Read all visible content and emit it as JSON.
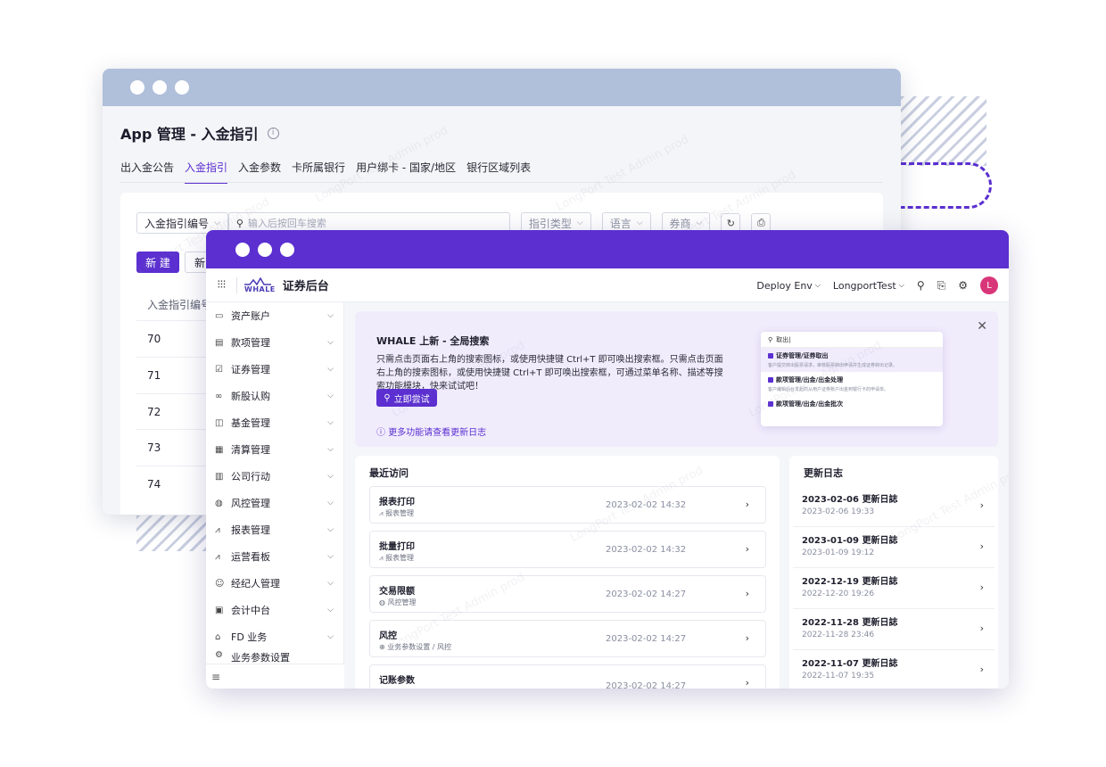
{
  "back_window": {
    "title": "App 管理 - 入金指引",
    "info_icon": "i",
    "tabs": [
      {
        "label": "出入金公告",
        "active": false
      },
      {
        "label": "入金指引",
        "active": true
      },
      {
        "label": "入金参数",
        "active": false
      },
      {
        "label": "卡所属银行",
        "active": false
      },
      {
        "label": "用户绑卡 - 国家/地区",
        "active": false
      },
      {
        "label": "银行区域列表",
        "active": false
      }
    ],
    "filters": {
      "field_select": "入金指引编号",
      "search_placeholder": "输入后按回车搜索",
      "type_select": "指引类型",
      "lang_select": "语言",
      "broker_select": "券商"
    },
    "buttons": {
      "new": "新 建",
      "new2": "新"
    },
    "table": {
      "column_header": "入金指引编号",
      "rows": [
        "70",
        "71",
        "72",
        "73",
        "74"
      ]
    }
  },
  "front_window": {
    "brand": {
      "logo_text": "WHALE",
      "title": "证券后台"
    },
    "header": {
      "env": "Deploy Env",
      "account": "LongportTest",
      "avatar": "L"
    },
    "sidebar": {
      "items": [
        {
          "label": "资产账户",
          "icon": "wallet-icon"
        },
        {
          "label": "款项管理",
          "icon": "document-icon"
        },
        {
          "label": "证券管理",
          "icon": "check-square-icon"
        },
        {
          "label": "新股认购",
          "icon": "link-icon"
        },
        {
          "label": "基金管理",
          "icon": "chart-box-icon"
        },
        {
          "label": "清算管理",
          "icon": "calendar-icon"
        },
        {
          "label": "公司行动",
          "icon": "building-icon"
        },
        {
          "label": "风控管理",
          "icon": "shield-icon"
        },
        {
          "label": "报表管理",
          "icon": "line-chart-icon"
        },
        {
          "label": "运营看板",
          "icon": "trend-icon"
        },
        {
          "label": "经纪人管理",
          "icon": "users-icon"
        },
        {
          "label": "会计中台",
          "icon": "ledger-icon"
        },
        {
          "label": "FD 业务",
          "icon": "bank-icon"
        },
        {
          "label": "业务参数设置",
          "icon": "settings-icon"
        }
      ],
      "collapse_icon": "≡"
    },
    "banner": {
      "title": "WHALE 上新 - 全局搜索",
      "desc": "只需点击页面右上角的搜索图标，或使用快捷键 Ctrl+T 即可唤出搜索框。只需点击页面右上角的搜索图标，或使用快捷键 Ctrl+T 即可唤出搜索框，可通过菜单名称、描述等搜索功能模块，快来试试吧！",
      "try_button": "立即尝试",
      "more_link": "更多功能请查看更新日志",
      "mini_search": {
        "query": "取出|",
        "results": [
          {
            "title": "证券管理/证券取出",
            "desc": "客户提交转出股票请求，审核股票转出申请并生成证券转出记录。"
          },
          {
            "title": "款项管理/出金/出金处理",
            "desc": "客户编辑后台发起的从用户证券账户出金到银行卡的申请单。"
          },
          {
            "title": "款项管理/出金/出金批次",
            "desc": ""
          }
        ]
      }
    },
    "recent": {
      "title": "最近访问",
      "items": [
        {
          "name": "报表打印",
          "path": "报表管理",
          "time": "2023-02-02 14:32"
        },
        {
          "name": "批量打印",
          "path": "报表管理",
          "time": "2023-02-02 14:32"
        },
        {
          "name": "交易限额",
          "path": "风控管理",
          "time": "2023-02-02 14:27"
        },
        {
          "name": "风控",
          "path": "业务参数设置  /  风控",
          "time": "2023-02-02 14:27"
        },
        {
          "name": "记账参数",
          "path": "",
          "time": "2023-02-02 14:27"
        }
      ]
    },
    "changelog": {
      "title": "更新日志",
      "items": [
        {
          "title": "2023-02-06 更新日誌",
          "date": "2023-02-06 19:33"
        },
        {
          "title": "2023-01-09 更新日誌",
          "date": "2023-01-09 19:12"
        },
        {
          "title": "2022-12-19 更新日誌",
          "date": "2022-12-20 19:26"
        },
        {
          "title": "2022-11-28 更新日誌",
          "date": "2022-11-28 23:46"
        },
        {
          "title": "2022-11-07 更新日誌",
          "date": "2022-11-07 19:35"
        }
      ]
    }
  },
  "watermark": "LongPort Test Admin prod",
  "colors": {
    "accent": "#5b2fd0",
    "back_titlebar": "#b0bfda",
    "avatar": "#d9367a",
    "banner_bg": "#f1ecfc"
  }
}
